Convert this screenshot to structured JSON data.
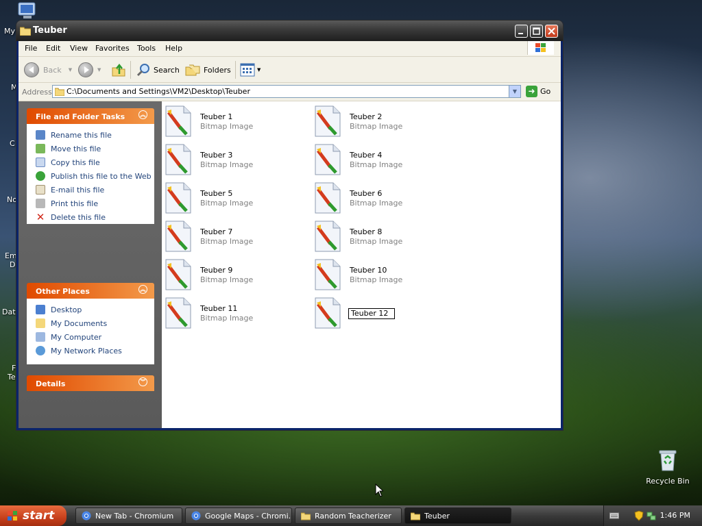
{
  "desktop": {
    "fragments": [
      "My",
      "M",
      "C",
      "No",
      "Em",
      "D",
      "Data",
      "F",
      "Te"
    ],
    "recycle_bin_label": "Recycle Bin"
  },
  "window": {
    "title": "Teuber",
    "menu": [
      "File",
      "Edit",
      "View",
      "Favorites",
      "Tools",
      "Help"
    ],
    "toolbar": {
      "back": "Back",
      "search": "Search",
      "folders": "Folders"
    },
    "address": {
      "label": "Address",
      "path": "C:\\Documents and Settings\\VM2\\Desktop\\Teuber",
      "go": "Go"
    },
    "file_tasks": {
      "title": "File and Folder Tasks",
      "items": [
        "Rename this file",
        "Move this file",
        "Copy this file",
        "Publish this file to the Web",
        "E-mail this file",
        "Print this file",
        "Delete this file"
      ]
    },
    "other_places": {
      "title": "Other Places",
      "items": [
        "Desktop",
        "My Documents",
        "My Computer",
        "My Network Places"
      ]
    },
    "details": {
      "title": "Details"
    },
    "files": [
      {
        "name": "Teuber 1",
        "type": "Bitmap Image"
      },
      {
        "name": "Teuber 2",
        "type": "Bitmap Image"
      },
      {
        "name": "Teuber 3",
        "type": "Bitmap Image"
      },
      {
        "name": "Teuber 4",
        "type": "Bitmap Image"
      },
      {
        "name": "Teuber 5",
        "type": "Bitmap Image"
      },
      {
        "name": "Teuber 6",
        "type": "Bitmap Image"
      },
      {
        "name": "Teuber 7",
        "type": "Bitmap Image"
      },
      {
        "name": "Teuber 8",
        "type": "Bitmap Image"
      },
      {
        "name": "Teuber 9",
        "type": "Bitmap Image"
      },
      {
        "name": "Teuber 10",
        "type": "Bitmap Image"
      },
      {
        "name": "Teuber 11",
        "type": "Bitmap Image"
      }
    ],
    "renaming_file": "Teuber 12"
  },
  "taskbar": {
    "start": "start",
    "buttons": [
      "New Tab - Chromium",
      "Google Maps - Chromi...",
      "Random Teacherizer",
      "Teuber"
    ],
    "clock": "1:46 PM"
  }
}
